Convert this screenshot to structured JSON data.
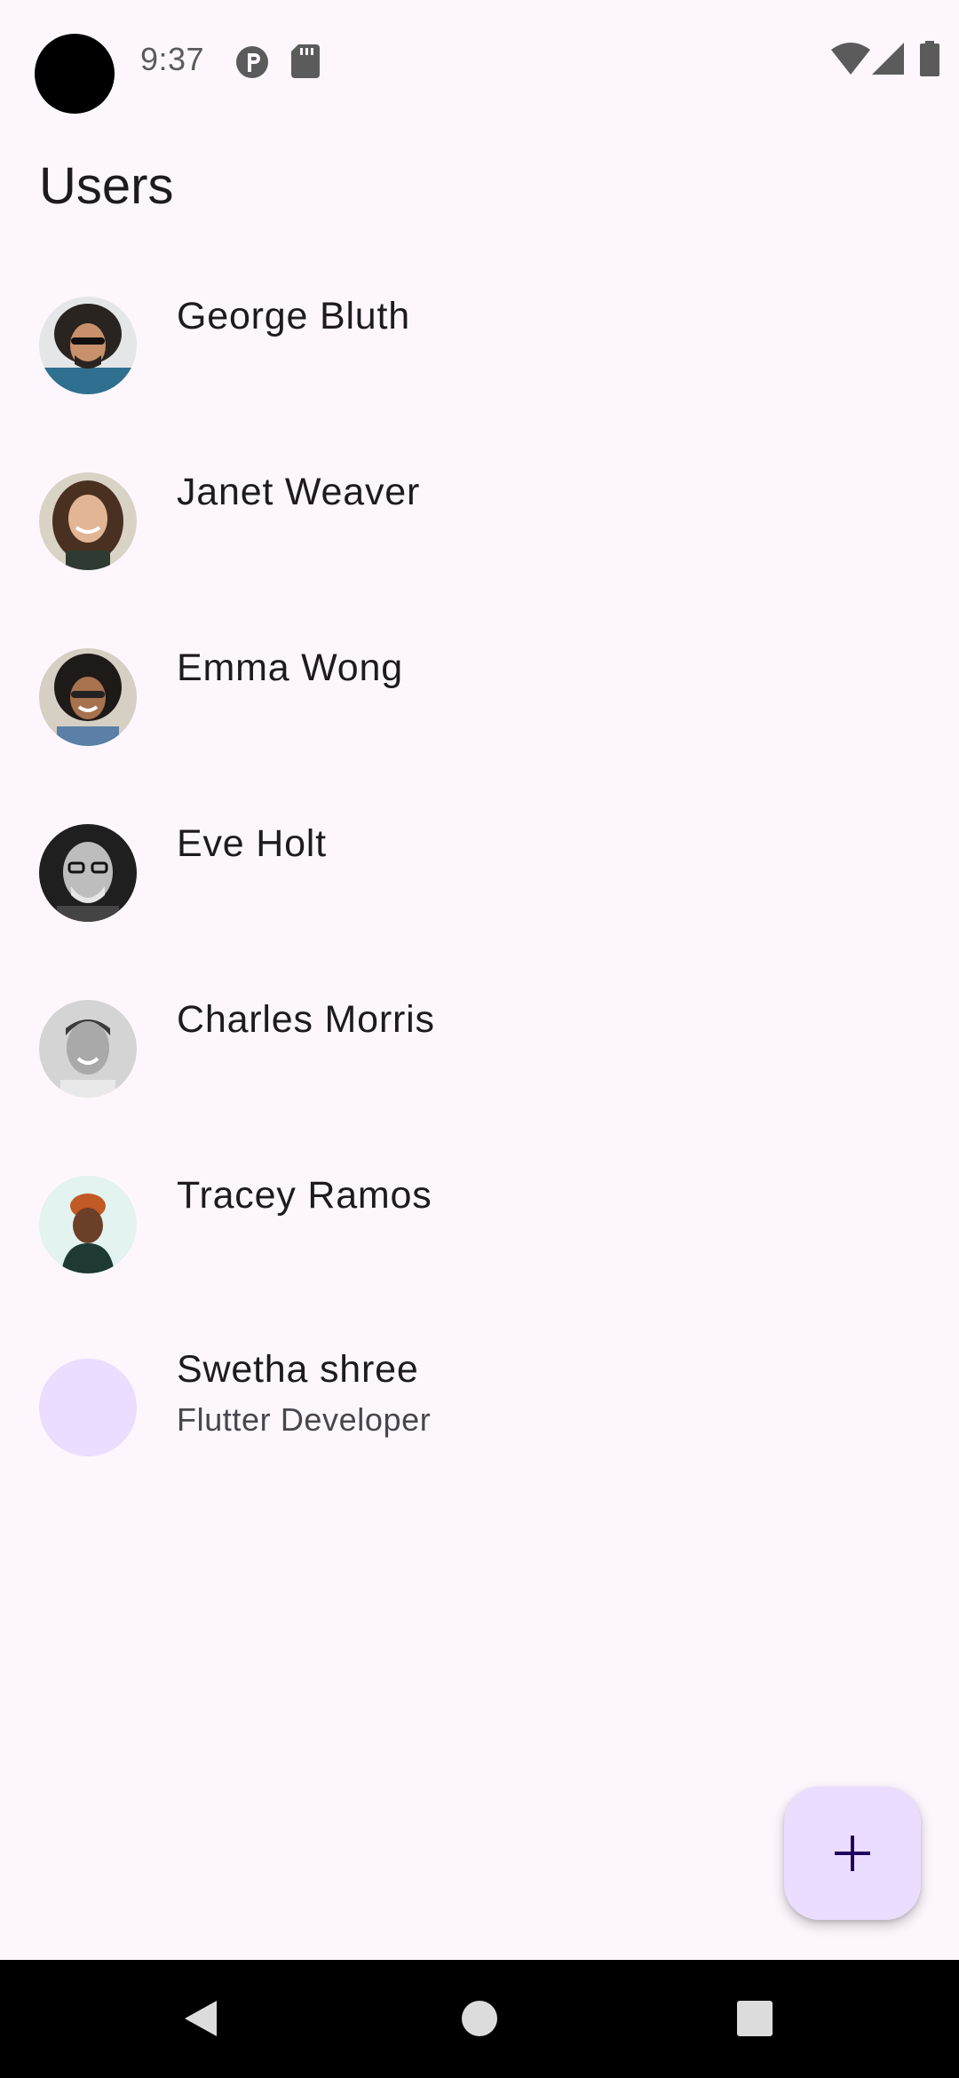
{
  "status_bar": {
    "time": "9:37",
    "left_icons": [
      "p-badge-icon",
      "sd-card-icon"
    ],
    "right_icons": [
      "wifi-icon",
      "cell-signal-icon",
      "battery-icon"
    ]
  },
  "app_bar": {
    "title": "Users"
  },
  "users": [
    {
      "name": "George Bluth",
      "subtitle": "",
      "avatar": "photo"
    },
    {
      "name": "Janet Weaver",
      "subtitle": "",
      "avatar": "photo"
    },
    {
      "name": "Emma Wong",
      "subtitle": "",
      "avatar": "photo"
    },
    {
      "name": "Eve Holt",
      "subtitle": "",
      "avatar": "photo"
    },
    {
      "name": "Charles Morris",
      "subtitle": "",
      "avatar": "photo"
    },
    {
      "name": "Tracey Ramos",
      "subtitle": "",
      "avatar": "photo"
    },
    {
      "name": "Swetha shree",
      "subtitle": "Flutter Developer",
      "avatar": "placeholder"
    }
  ],
  "fab": {
    "icon": "plus-icon"
  },
  "nav_bar": {
    "icons": [
      "back-icon",
      "home-icon",
      "recents-icon"
    ]
  },
  "colors": {
    "background": "#fdf7fd",
    "fab_background": "#eaddff",
    "fab_icon": "#21005d",
    "placeholder_avatar": "#eaddff",
    "text_primary": "#1d1b20",
    "text_secondary": "#49454f"
  }
}
